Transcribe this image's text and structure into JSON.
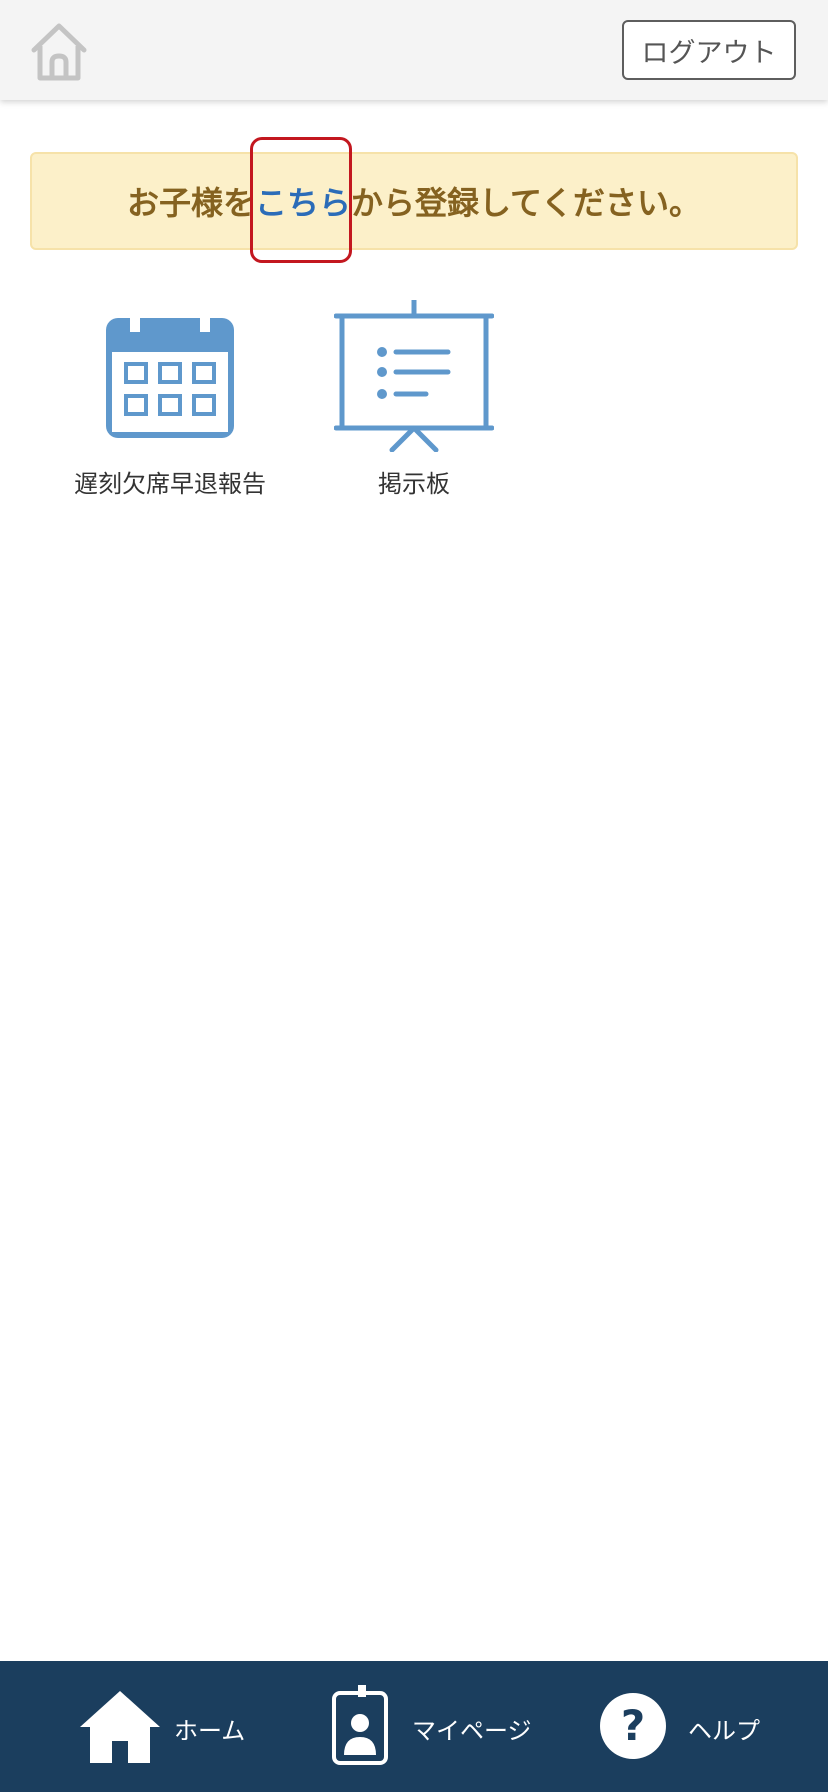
{
  "header": {
    "home_icon": "home-outline-icon",
    "logout_label": "ログアウト"
  },
  "notice": {
    "prefix": "お子様を",
    "link": "こちら",
    "suffix": "から登録してください。"
  },
  "menu": [
    {
      "label": "遅刻欠席早退報告",
      "icon": "calendar-icon"
    },
    {
      "label": "掲示板",
      "icon": "presentation-board-icon"
    }
  ],
  "bottom_nav": [
    {
      "label": "ホーム",
      "icon": "home-icon"
    },
    {
      "label": "マイページ",
      "icon": "id-badge-icon"
    },
    {
      "label": "ヘルプ",
      "icon": "help-icon"
    }
  ],
  "colors": {
    "header_bg": "#f4f4f4",
    "notice_bg": "#fcf0c9",
    "notice_text": "#856220",
    "link": "#2b6cb8",
    "highlight": "#c3171f",
    "icon_blue": "#5f98cc",
    "nav_bg": "#1b3e5e"
  }
}
